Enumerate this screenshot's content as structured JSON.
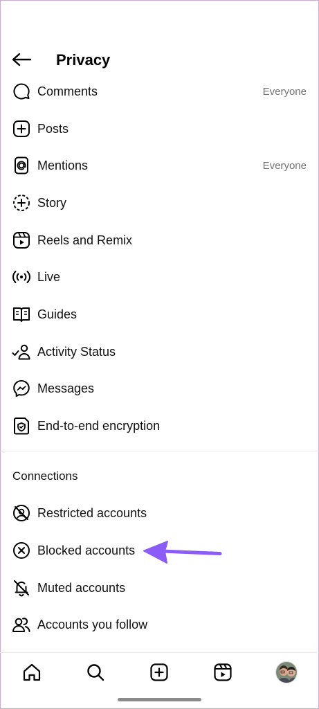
{
  "header": {
    "title": "Privacy"
  },
  "items": [
    {
      "label": "Comments",
      "value": "Everyone",
      "icon": "comment-icon"
    },
    {
      "label": "Posts",
      "value": "",
      "icon": "plus-square-icon"
    },
    {
      "label": "Mentions",
      "value": "Everyone",
      "icon": "at-icon"
    },
    {
      "label": "Story",
      "value": "",
      "icon": "story-icon"
    },
    {
      "label": "Reels and Remix",
      "value": "",
      "icon": "reels-icon"
    },
    {
      "label": "Live",
      "value": "",
      "icon": "live-icon"
    },
    {
      "label": "Guides",
      "value": "",
      "icon": "guides-icon"
    },
    {
      "label": "Activity Status",
      "value": "",
      "icon": "activity-status-icon"
    },
    {
      "label": "Messages",
      "value": "",
      "icon": "messenger-icon"
    },
    {
      "label": "End-to-end encryption",
      "value": "",
      "icon": "encryption-icon"
    }
  ],
  "connections": {
    "title": "Connections",
    "items": [
      {
        "label": "Restricted accounts",
        "icon": "restricted-icon"
      },
      {
        "label": "Blocked accounts",
        "icon": "blocked-icon"
      },
      {
        "label": "Muted accounts",
        "icon": "muted-bell-icon"
      },
      {
        "label": "Accounts you follow",
        "icon": "following-icon"
      }
    ]
  },
  "nav": [
    "home-icon",
    "search-icon",
    "create-icon",
    "reels-icon",
    "profile-avatar"
  ],
  "colors": {
    "annotation_arrow": "#8b5cf6",
    "secondary_text": "#737373"
  }
}
